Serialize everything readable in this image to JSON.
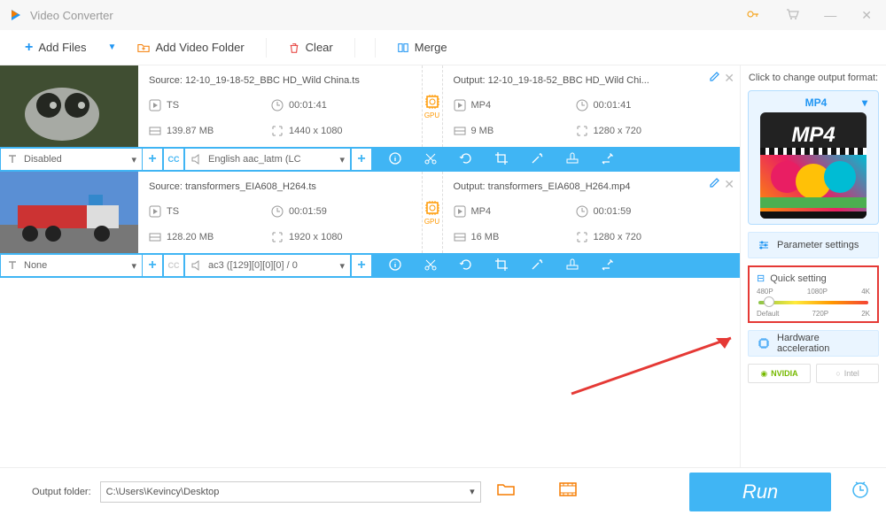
{
  "app": {
    "title": "Video Converter"
  },
  "toolbar": {
    "add_files": "Add Files",
    "add_folder": "Add Video Folder",
    "clear": "Clear",
    "merge": "Merge"
  },
  "items": [
    {
      "source_label": "Source: 12-10_19-18-52_BBC HD_Wild China.ts",
      "src_format": "TS",
      "src_duration": "00:01:41",
      "src_size": "139.87 MB",
      "src_res": "1440 x 1080",
      "output_label": "Output: 12-10_19-18-52_BBC HD_Wild Chi...",
      "out_format": "MP4",
      "out_duration": "00:01:41",
      "out_size": "9 MB",
      "out_res": "1280 x 720",
      "subtitle": "Disabled",
      "audio": "English aac_latm (LC",
      "gpu": "GPU"
    },
    {
      "source_label": "Source: transformers_EIA608_H264.ts",
      "src_format": "TS",
      "src_duration": "00:01:59",
      "src_size": "128.20 MB",
      "src_res": "1920 x 1080",
      "output_label": "Output: transformers_EIA608_H264.mp4",
      "out_format": "MP4",
      "out_duration": "00:01:59",
      "out_size": "16 MB",
      "out_res": "1280 x 720",
      "subtitle": "None",
      "audio": "ac3 ([129][0][0][0] / 0",
      "gpu": "GPU"
    }
  ],
  "side": {
    "change_label": "Click to change output format:",
    "format": "MP4",
    "mp4_badge": "MP4",
    "params": "Parameter settings",
    "quick_title": "Quick setting",
    "ticks_top": [
      "480P",
      "1080P",
      "4K"
    ],
    "ticks_bottom": [
      "Default",
      "720P",
      "2K"
    ],
    "hw_accel": "Hardware acceleration",
    "nvidia": "NVIDIA",
    "intel": "Intel"
  },
  "bottom": {
    "label": "Output folder:",
    "path": "C:\\Users\\Kevincy\\Desktop",
    "run": "Run"
  }
}
